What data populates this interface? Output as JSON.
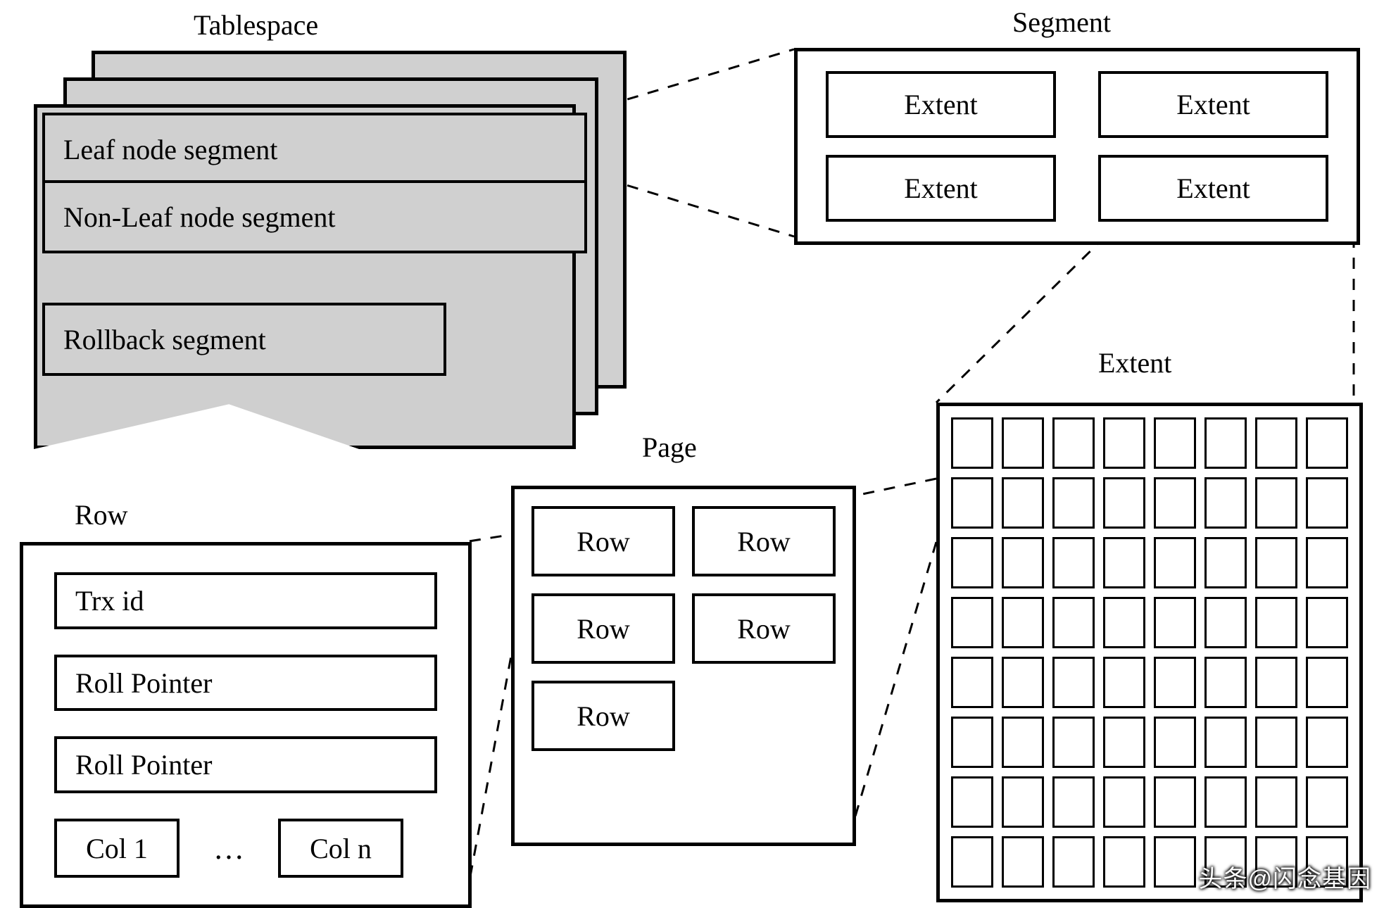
{
  "titles": {
    "tablespace": "Tablespace",
    "segment": "Segment",
    "page": "Page",
    "row": "Row",
    "extent": "Extent"
  },
  "tablespace": {
    "rows": {
      "leaf": "Leaf node segment",
      "nonleaf": "Non-Leaf node segment",
      "rollback": "Rollback segment"
    }
  },
  "segment": {
    "extents": [
      "Extent",
      "Extent",
      "Extent",
      "Extent"
    ]
  },
  "page": {
    "rows": [
      "Row",
      "Row",
      "Row",
      "Row",
      "Row"
    ]
  },
  "row": {
    "trx": "Trx id",
    "roll1": "Roll Pointer",
    "roll2": "Roll Pointer",
    "col1": "Col 1",
    "dots": "…",
    "coln": "Col n"
  },
  "extent_grid": {
    "cols": 8,
    "rows": 8
  },
  "watermark": "头条@闪念基因"
}
